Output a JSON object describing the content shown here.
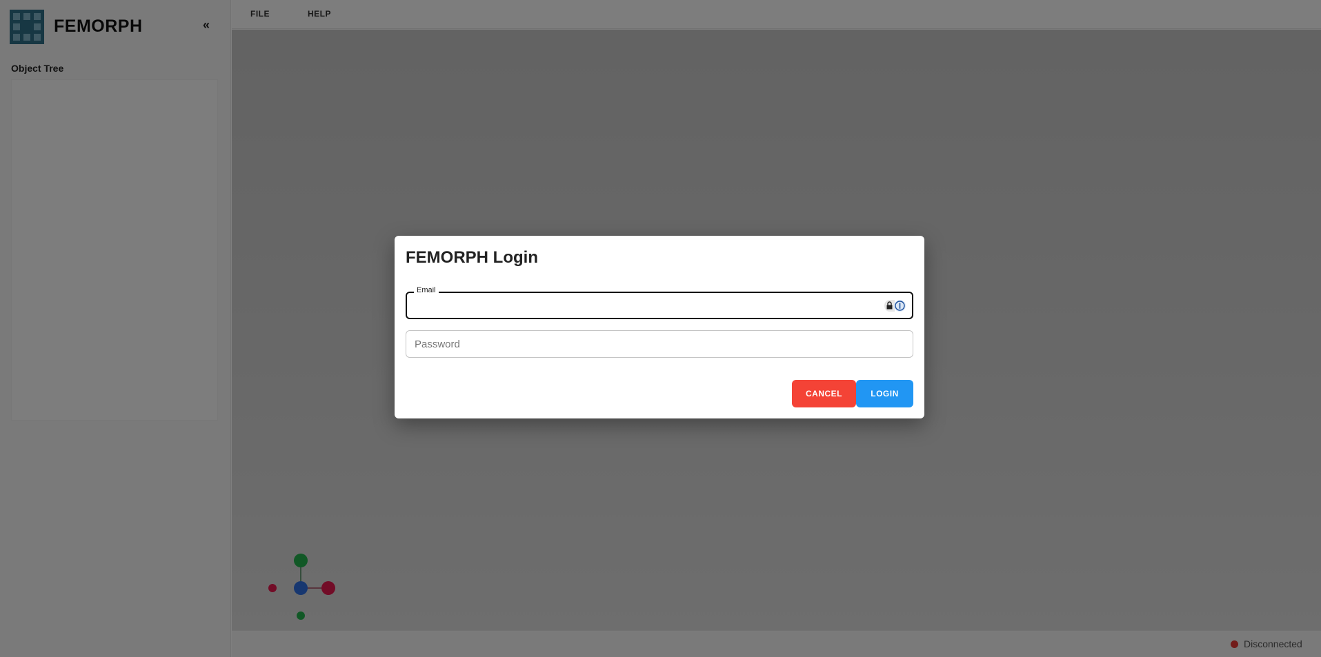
{
  "app": {
    "name": "FEMORPH",
    "collapse_icon": "double-chevron-left-icon",
    "collapse_label": "«"
  },
  "sidebar": {
    "tree_title": "Object Tree"
  },
  "menu": {
    "items": [
      {
        "label": "FILE"
      },
      {
        "label": "HELP"
      }
    ]
  },
  "viewport": {
    "axis_colors": {
      "x": "#e5194f",
      "y": "#22b14c",
      "z": "#2f6fe0"
    }
  },
  "status": {
    "text": "Disconnected",
    "color": "#e53935"
  },
  "login_dialog": {
    "title": "FEMORPH Login",
    "email": {
      "label": "Email",
      "value": ""
    },
    "password": {
      "placeholder": "Password",
      "value": ""
    },
    "cancel_label": "CANCEL",
    "login_label": "LOGIN",
    "colors": {
      "cancel": "#f44336",
      "login": "#2196f3"
    }
  }
}
